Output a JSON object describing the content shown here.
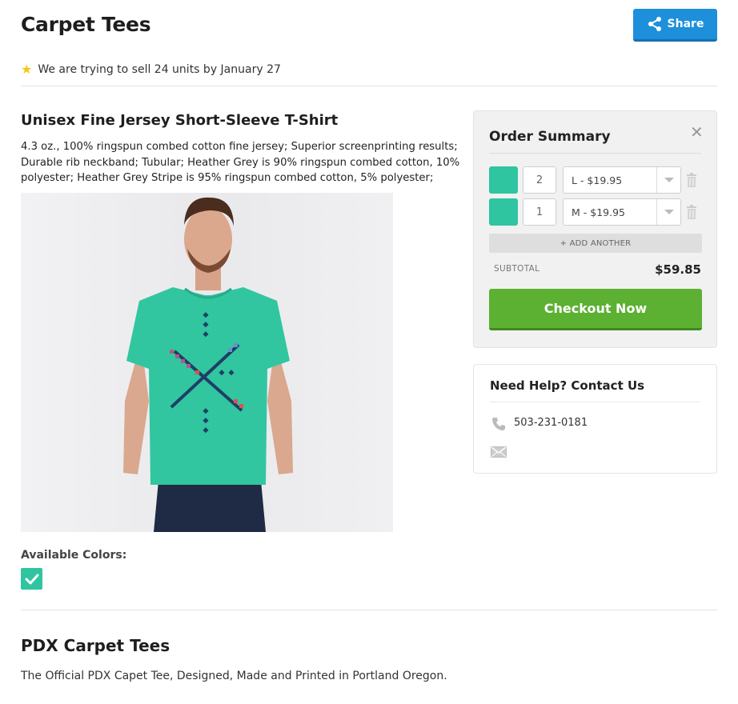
{
  "header": {
    "title": "Carpet Tees",
    "share_label": "Share",
    "goal_text": "We are trying to sell 24 units by January 27"
  },
  "product": {
    "title": "Unisex Fine Jersey Short-Sleeve T-Shirt",
    "description": "4.3 oz., 100% ringspun combed cotton fine jersey; Superior screenprinting results; Durable rib neckband; Tubular; Heather Grey is 90% ringspun combed cotton, 10% polyester; Heather Grey Stripe is 95% ringspun combed cotton, 5% polyester;",
    "colors_label": "Available Colors:",
    "colors": [
      {
        "hex": "#2ec5a0",
        "selected": true
      }
    ]
  },
  "order_summary": {
    "title": "Order Summary",
    "items": [
      {
        "color": "#2ec5a0",
        "quantity": "2",
        "option": "L - $19.95"
      },
      {
        "color": "#2ec5a0",
        "quantity": "1",
        "option": "M - $19.95"
      }
    ],
    "add_another_label": "+ ADD ANOTHER",
    "subtotal_label": "SUBTOTAL",
    "subtotal_value": "$59.85",
    "checkout_label": "Checkout Now"
  },
  "help": {
    "title": "Need Help? Contact Us",
    "phone": "503-231-0181"
  },
  "store": {
    "title": "PDX Carpet Tees",
    "description": "The Official PDX Capet Tee, Designed, Made and Printed in Portland Oregon."
  },
  "theme": {
    "accent_blue": "#1d8fdb",
    "checkout_green": "#5cb032",
    "shirt_teal": "#2ec5a0"
  }
}
